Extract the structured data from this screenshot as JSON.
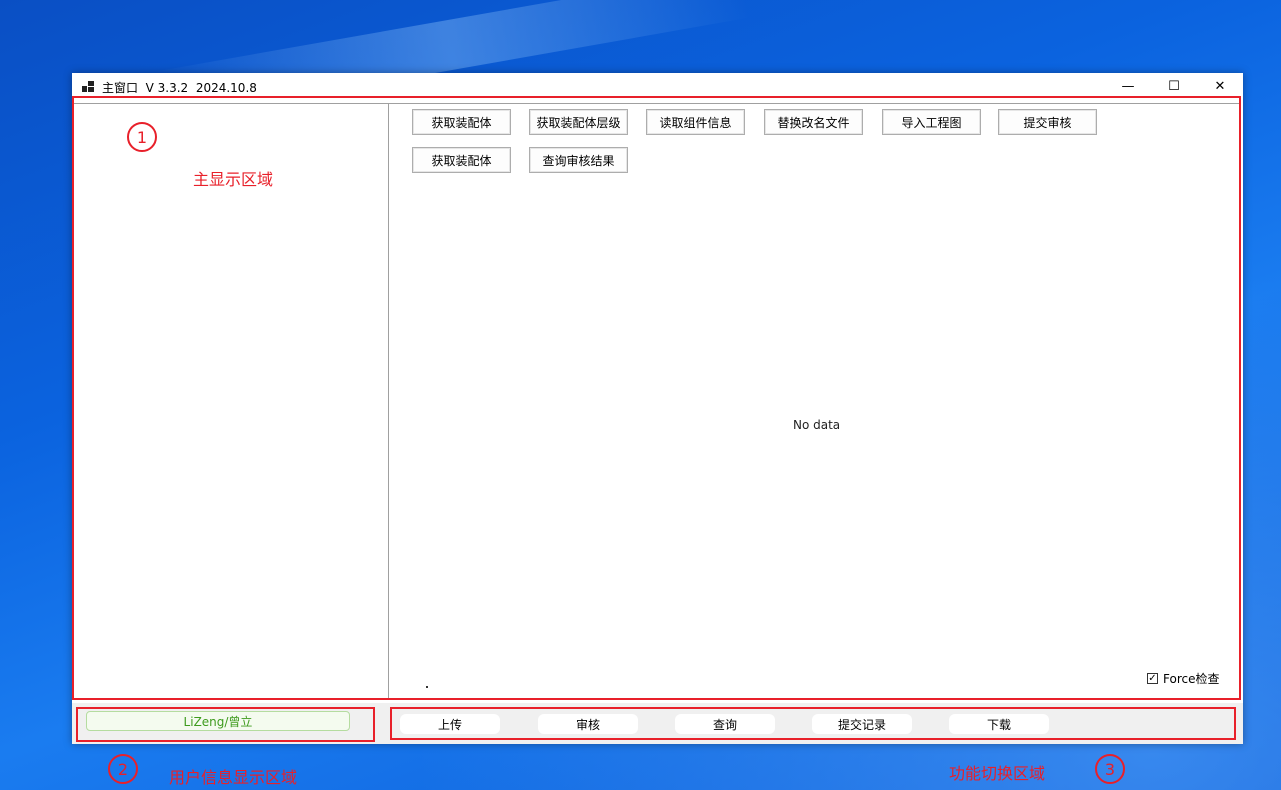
{
  "window": {
    "title": "主窗口  V 3.3.2  2024.10.8",
    "minimize": "—",
    "maximize": "☐",
    "close": "✕"
  },
  "toolbar": {
    "row1": [
      "获取装配体",
      "获取装配体层级",
      "读取组件信息",
      "替换改名文件",
      "导入工程图",
      "提交审核"
    ],
    "row2": [
      "获取装配体",
      "查询审核结果"
    ]
  },
  "main": {
    "empty_text": "No data",
    "force_label": "Force检查",
    "force_checked": true
  },
  "footer": {
    "user": "LiZeng/曾立",
    "functions": [
      "上传",
      "审核",
      "查询",
      "提交记录",
      "下载"
    ]
  },
  "annotations": {
    "num1": "1",
    "label1": "主显示区域",
    "num2": "2",
    "label2": "用户信息显示区域",
    "num3": "3",
    "label3": "功能切换区域",
    "color": "#e8202a"
  }
}
